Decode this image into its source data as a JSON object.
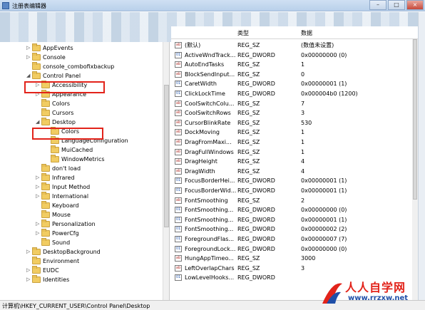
{
  "window": {
    "title": "注册表编辑器",
    "buttons": {
      "minimize": "–",
      "maximize": "□",
      "close": "×"
    }
  },
  "tree": {
    "items": [
      {
        "label": "AppEvents",
        "expanded": false,
        "has_children": true
      },
      {
        "label": "Console",
        "expanded": false,
        "has_children": true
      },
      {
        "label": "console_combofixbackup",
        "expanded": false,
        "has_children": false
      },
      {
        "label": "Control Panel",
        "expanded": true,
        "has_children": true,
        "highlighted": true
      },
      {
        "label": "Accessibility",
        "expanded": false,
        "has_children": true
      },
      {
        "label": "Appearance",
        "expanded": false,
        "has_children": true
      },
      {
        "label": "Colors",
        "expanded": false,
        "has_children": false
      },
      {
        "label": "Cursors",
        "expanded": false,
        "has_children": false
      },
      {
        "label": "Desktop",
        "expanded": true,
        "has_children": true,
        "highlighted": true,
        "selected": true
      },
      {
        "label": "Colors",
        "expanded": false,
        "has_children": false
      },
      {
        "label": "LanguageConfiguration",
        "expanded": false,
        "has_children": false
      },
      {
        "label": "MuiCached",
        "expanded": false,
        "has_children": false
      },
      {
        "label": "WindowMetrics",
        "expanded": false,
        "has_children": false
      },
      {
        "label": "don't load",
        "expanded": false,
        "has_children": false
      },
      {
        "label": "Infrared",
        "expanded": false,
        "has_children": true
      },
      {
        "label": "Input Method",
        "expanded": false,
        "has_children": true
      },
      {
        "label": "International",
        "expanded": false,
        "has_children": true
      },
      {
        "label": "Keyboard",
        "expanded": false,
        "has_children": false
      },
      {
        "label": "Mouse",
        "expanded": false,
        "has_children": false
      },
      {
        "label": "Personalization",
        "expanded": false,
        "has_children": true
      },
      {
        "label": "PowerCfg",
        "expanded": false,
        "has_children": true
      },
      {
        "label": "Sound",
        "expanded": false,
        "has_children": false
      },
      {
        "label": "DesktopBackground",
        "expanded": false,
        "has_children": true
      },
      {
        "label": "Environment",
        "expanded": false,
        "has_children": false
      },
      {
        "label": "EUDC",
        "expanded": false,
        "has_children": true
      },
      {
        "label": "Identities",
        "expanded": false,
        "has_children": true
      }
    ]
  },
  "values_table": {
    "headers": {
      "name": "",
      "type": "类型",
      "data": "数据"
    },
    "rows": [
      {
        "icon": "ab",
        "name": "(默认)",
        "type": "REG_SZ",
        "data": "(数值未设置)"
      },
      {
        "icon": "dword",
        "name": "ActiveWndTrack...",
        "type": "REG_DWORD",
        "data": "0x00000000 (0)"
      },
      {
        "icon": "ab",
        "name": "AutoEndTasks",
        "type": "REG_SZ",
        "data": "1"
      },
      {
        "icon": "ab",
        "name": "BlockSendInput...",
        "type": "REG_SZ",
        "data": "0"
      },
      {
        "icon": "dword",
        "name": "CaretWidth",
        "type": "REG_DWORD",
        "data": "0x00000001 (1)"
      },
      {
        "icon": "dword",
        "name": "ClickLockTime",
        "type": "REG_DWORD",
        "data": "0x000004b0 (1200)"
      },
      {
        "icon": "ab",
        "name": "CoolSwitchColu...",
        "type": "REG_SZ",
        "data": "7"
      },
      {
        "icon": "ab",
        "name": "CoolSwitchRows",
        "type": "REG_SZ",
        "data": "3"
      },
      {
        "icon": "ab",
        "name": "CursorBlinkRate",
        "type": "REG_SZ",
        "data": "530"
      },
      {
        "icon": "ab",
        "name": "DockMoving",
        "type": "REG_SZ",
        "data": "1"
      },
      {
        "icon": "ab",
        "name": "DragFromMaxi...",
        "type": "REG_SZ",
        "data": "1"
      },
      {
        "icon": "ab",
        "name": "DragFullWindows",
        "type": "REG_SZ",
        "data": "1"
      },
      {
        "icon": "ab",
        "name": "DragHeight",
        "type": "REG_SZ",
        "data": "4"
      },
      {
        "icon": "ab",
        "name": "DragWidth",
        "type": "REG_SZ",
        "data": "4"
      },
      {
        "icon": "dword",
        "name": "FocusBorderHei...",
        "type": "REG_DWORD",
        "data": "0x00000001 (1)"
      },
      {
        "icon": "dword",
        "name": "FocusBorderWid...",
        "type": "REG_DWORD",
        "data": "0x00000001 (1)"
      },
      {
        "icon": "ab",
        "name": "FontSmoothing",
        "type": "REG_SZ",
        "data": "2"
      },
      {
        "icon": "dword",
        "name": "FontSmoothing...",
        "type": "REG_DWORD",
        "data": "0x00000000 (0)"
      },
      {
        "icon": "dword",
        "name": "FontSmoothing...",
        "type": "REG_DWORD",
        "data": "0x00000001 (1)"
      },
      {
        "icon": "dword",
        "name": "FontSmoothing...",
        "type": "REG_DWORD",
        "data": "0x00000002 (2)"
      },
      {
        "icon": "dword",
        "name": "ForegroundFlas...",
        "type": "REG_DWORD",
        "data": "0x00000007 (7)"
      },
      {
        "icon": "dword",
        "name": "ForegroundLock...",
        "type": "REG_DWORD",
        "data": "0x00000000 (0)"
      },
      {
        "icon": "ab",
        "name": "HungAppTimeo...",
        "type": "REG_SZ",
        "data": "3000"
      },
      {
        "icon": "ab",
        "name": "LeftOverlapChars",
        "type": "REG_SZ",
        "data": "3"
      },
      {
        "icon": "dword",
        "name": "LowLevelHooks...",
        "type": "REG_DWORD",
        "data": ""
      }
    ]
  },
  "status_bar": {
    "path": "计算机\\HKEY_CURRENT_USER\\Control Panel\\Desktop"
  },
  "watermark": {
    "title": "人人自学网",
    "url": "www.rrzxw.net"
  },
  "colors": {
    "highlight_box": "#e2231a",
    "folder": "#f1cc62",
    "watermark_red": "#e2231a",
    "watermark_blue": "#1f4fa8"
  }
}
